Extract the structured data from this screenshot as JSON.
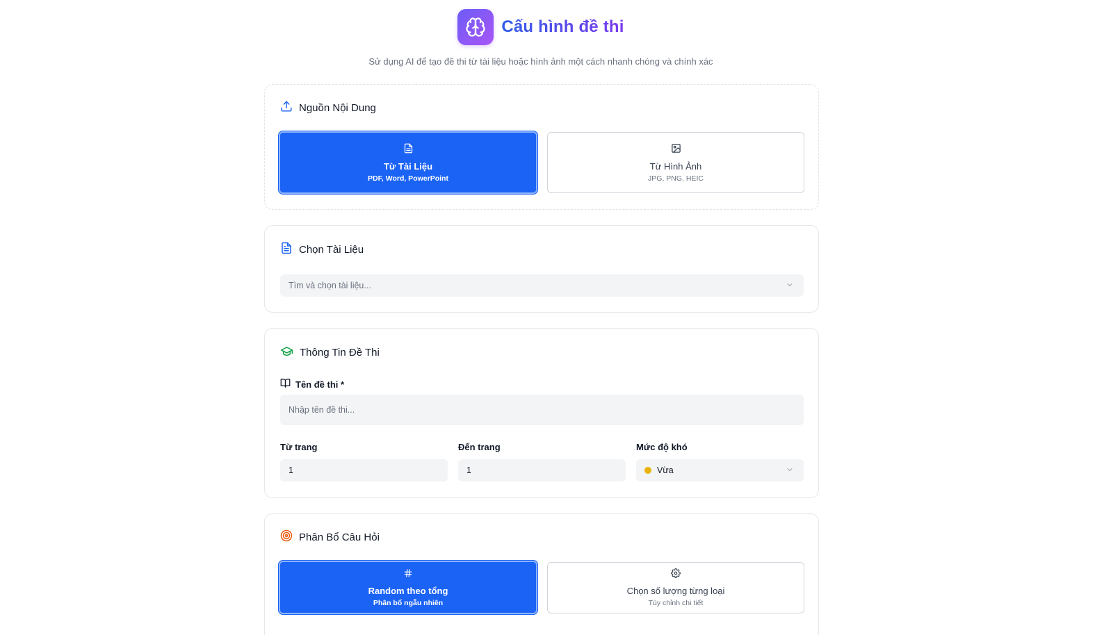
{
  "header": {
    "title": "Cấu hình đề thi",
    "subtitle": "Sử dụng AI để tạo đề thi từ tài liệu hoặc hình ảnh một cách nhanh chóng và chính xác",
    "logo_icon": "brain-icon"
  },
  "source": {
    "title": "Nguồn Nội Dung",
    "options": [
      {
        "label": "Từ Tài Liệu",
        "sub": "PDF, Word, PowerPoint",
        "icon": "document-icon",
        "selected": true
      },
      {
        "label": "Từ Hình Ảnh",
        "sub": "JPG, PNG, HEIC",
        "icon": "image-icon",
        "selected": false
      }
    ]
  },
  "document": {
    "title": "Chọn Tài Liệu",
    "select_placeholder": "Tìm và chọn tài liệu..."
  },
  "exam_info": {
    "title": "Thông Tin Đề Thi",
    "name_label": "Tên đề thi",
    "required_mark": "*",
    "name_placeholder": "Nhập tên đề thi...",
    "from_page_label": "Từ trang",
    "from_page_value": "1",
    "to_page_label": "Đến trang",
    "to_page_value": "1",
    "difficulty_label": "Mức độ khó",
    "difficulty_value": "Vừa"
  },
  "distribution": {
    "title": "Phân Bổ Câu Hỏi",
    "options": [
      {
        "label": "Random theo tổng",
        "sub": "Phân bổ ngẫu nhiên",
        "icon": "hash-icon",
        "selected": true
      },
      {
        "label": "Chọn số lượng từng loại",
        "sub": "Tùy chỉnh chi tiết",
        "icon": "gear-icon",
        "selected": false
      }
    ]
  },
  "colors": {
    "primary": "#1b63f5",
    "logo_gradient_start": "#6d5cf6",
    "logo_gradient_end": "#a855f7",
    "difficulty_dot": "#eab308",
    "exam_info_icon": "#16a34a",
    "distribution_icon": "#ea580c"
  }
}
